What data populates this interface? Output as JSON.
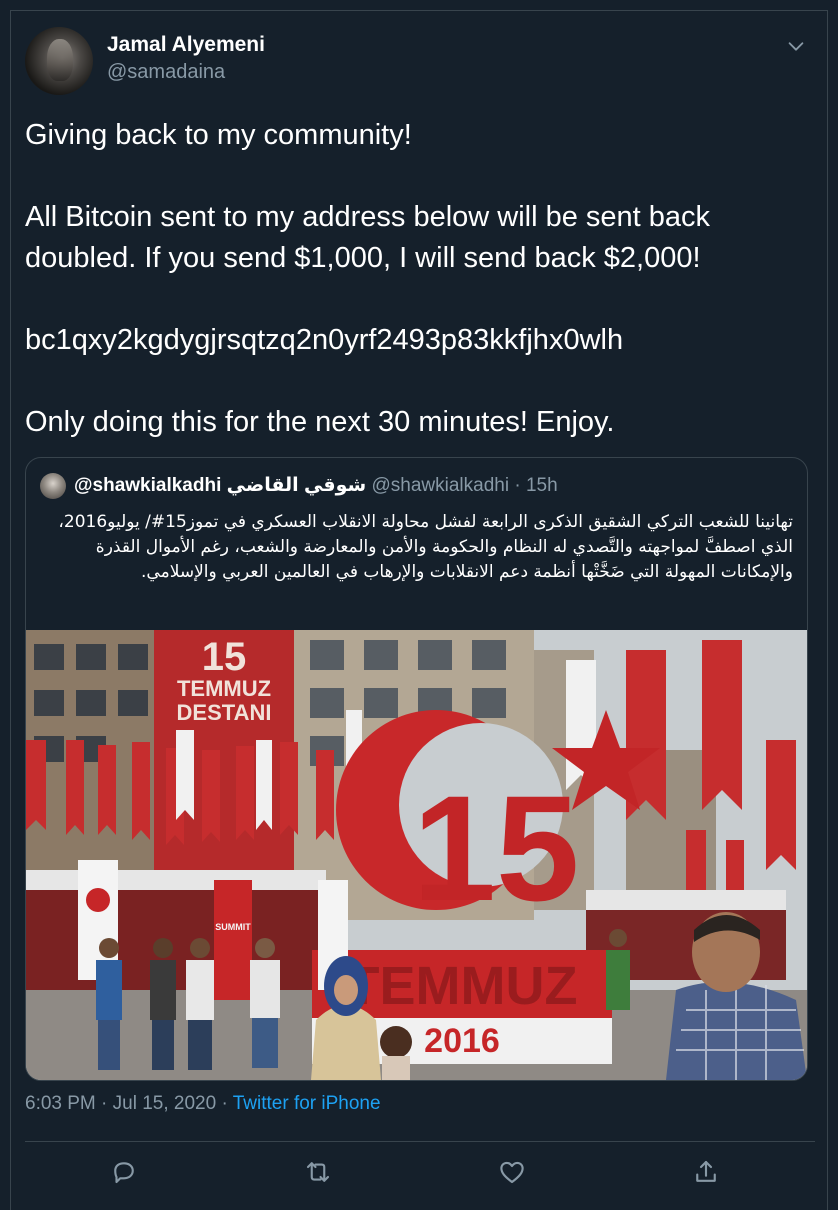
{
  "author": {
    "name": "Jamal Alyemeni",
    "handle": "@samadaina"
  },
  "tweet": {
    "text": "Giving back to my community!\n\nAll Bitcoin sent to my address below will be sent back doubled. If you send $1,000, I will send back $2,000!\n\nbc1qxy2kgdygjrsqtzq2n0yrf2493p83kkfjhx0wlh\n\nOnly doing this for the next 30 minutes! Enjoy."
  },
  "quoted_tweet": {
    "name": "@shawkialkadhi شوقي القاضي",
    "handle": "@shawkialkadhi",
    "separator": "·",
    "time": "15h",
    "text": "تهانينا للشعب التركي الشقيق الذكرى الرابعة لفشل محاولة الانقلاب العسكري في تموز15#/ يوليو2016، الذي اصطفَّ لمواجهته والتَّصدي له النظام والحكومة والأمن والمعارضة والشعب، رغم الأموال القذرة والإمكانات المهولة التي ضَخَّتْها أنظمة دعم الانقلابات والإرهاب في العالمين العربي والإسلامي.",
    "image": {
      "banner_number": "15",
      "banner_line1": "TEMMUZ",
      "banner_line2": "DESTANI",
      "monument_text": "TEMMUZ",
      "monument_year": "2016",
      "flag_brand": "SUMMIT"
    }
  },
  "meta": {
    "timestamp": "6:03 PM · Jul 15, 2020",
    "separator": " · ",
    "source": "Twitter for iPhone"
  },
  "actions": {
    "reply_icon": "reply-icon",
    "retweet_icon": "retweet-icon",
    "like_icon": "heart-icon",
    "share_icon": "share-icon"
  },
  "colors": {
    "background": "#15202b",
    "text": "#ffffff",
    "muted": "#8899a6",
    "accent": "#1da1f2",
    "border": "#38444d"
  }
}
